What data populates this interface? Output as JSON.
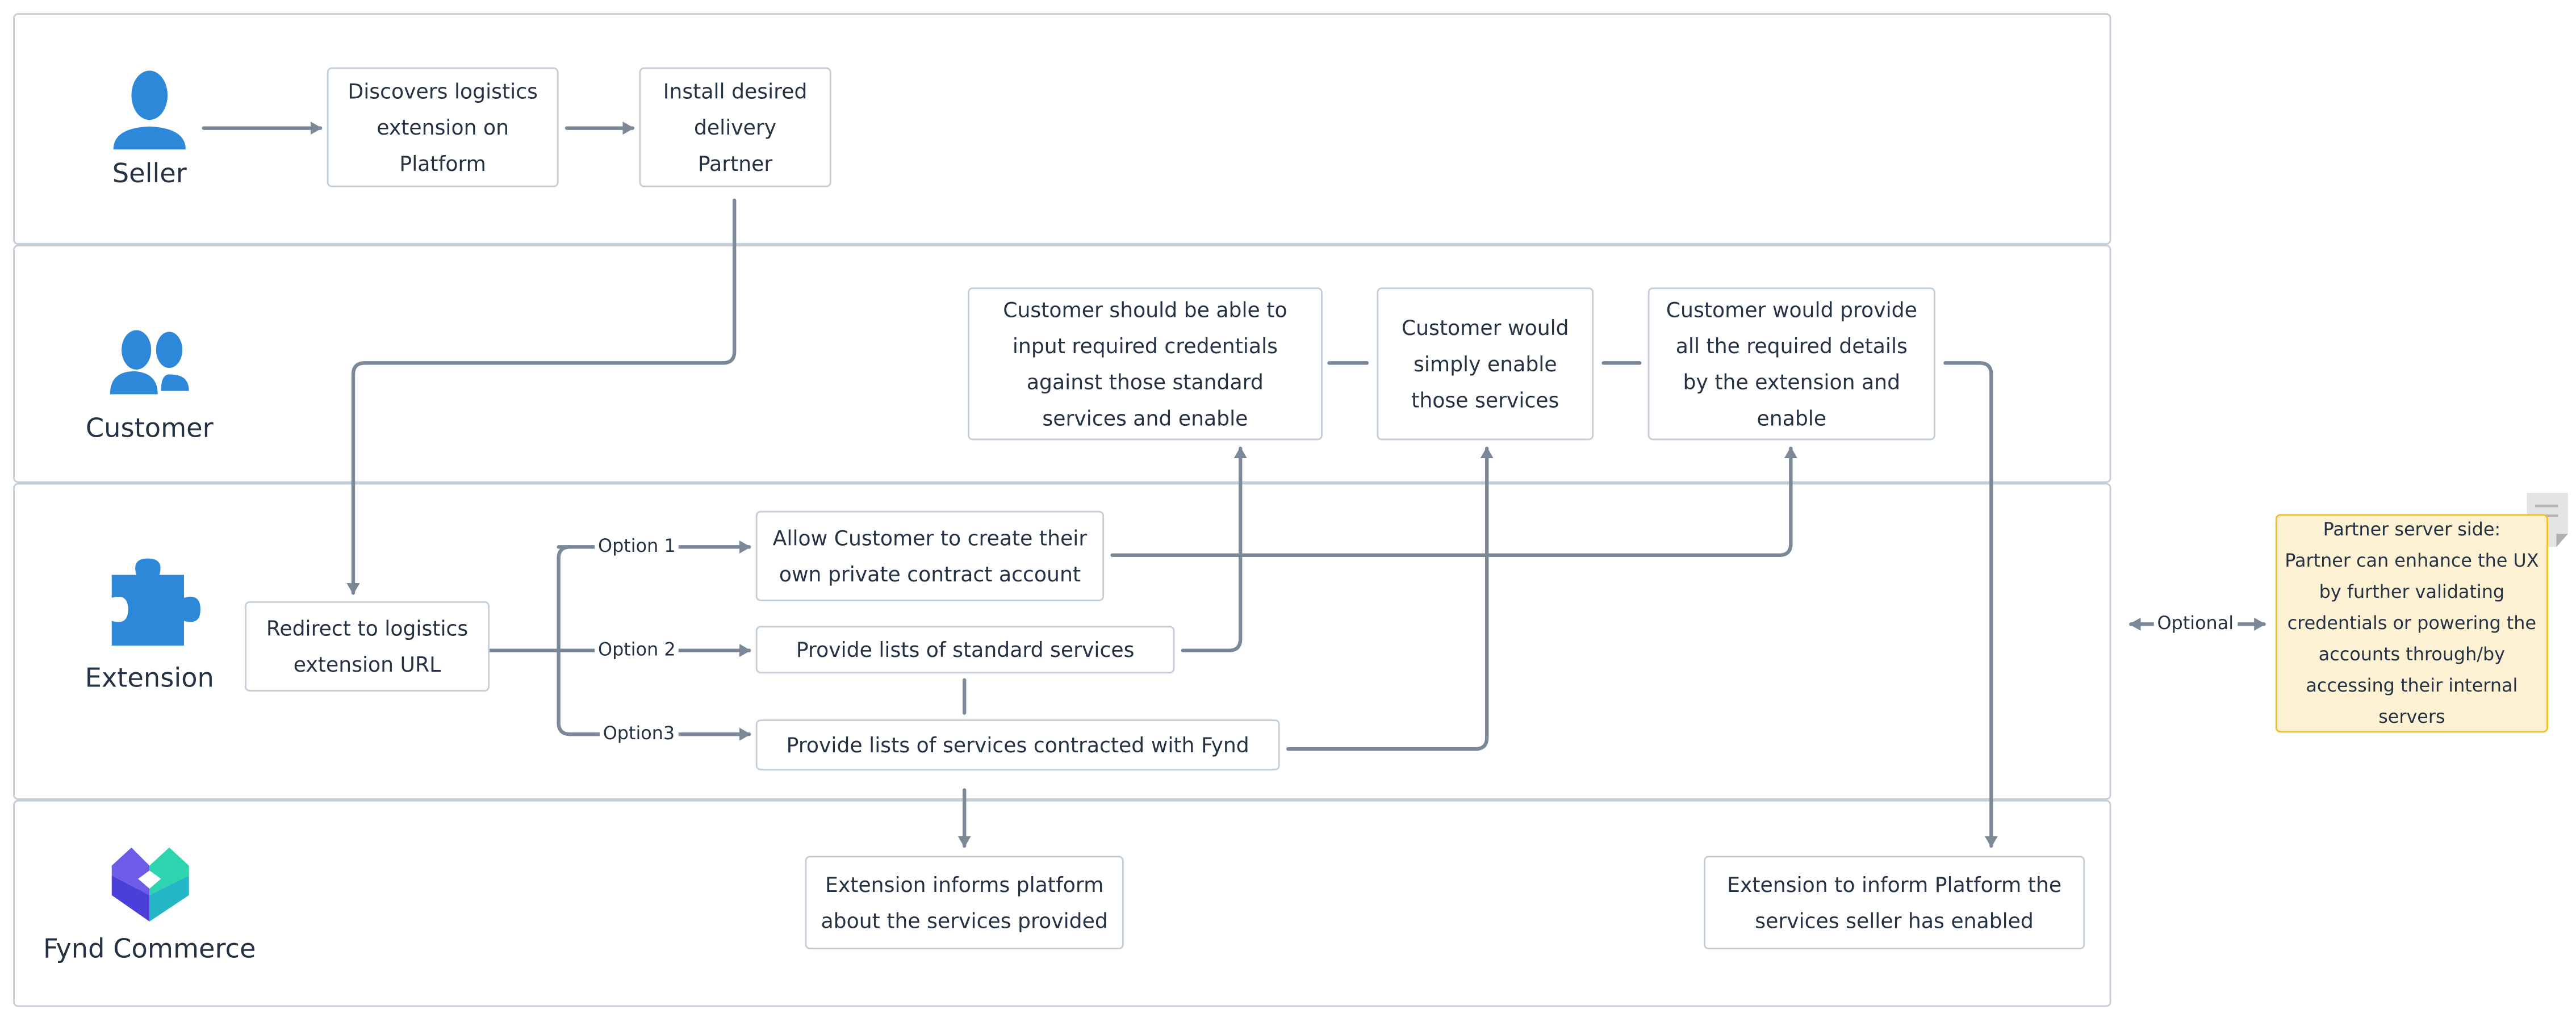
{
  "lanes": [
    {
      "label": "Seller",
      "icon": "person-icon"
    },
    {
      "label": "Customer",
      "icon": "people-icon"
    },
    {
      "label": "Extension",
      "icon": "puzzle-icon"
    },
    {
      "label": "Fynd Commerce",
      "icon": "fynd-logo"
    }
  ],
  "boxes": {
    "discovers": "Discovers logistics\nextension on\nPlatform",
    "install": "Install desired\ndelivery\nPartner",
    "credentials": "Customer should be able to\ninput required credentials\nagainst those standard\nservices and enable",
    "simply_enable": "Customer would\nsimply enable\nthose services",
    "provide_details": "Customer would provide\nall the required details\nby the extension and\nenable",
    "redirect": "Redirect to logistics\nextension URL",
    "allow_account": "Allow Customer to create their\nown private contract account",
    "standard_services": "Provide lists of standard services",
    "contracted_services": "Provide lists of services contracted with Fynd",
    "informs_platform": "Extension informs platform\nabout the services provided",
    "inform_enabled": "Extension to inform Platform the\nservices seller has enabled"
  },
  "options": {
    "option1": "Option 1",
    "option2": "Option 2",
    "option3": "Option3"
  },
  "optional_label": "Optional",
  "note": "Partner server side:\nPartner can enhance the UX\nby further validating\ncredentials or powering the\naccounts through/by\naccessing their internal\nservers",
  "colors": {
    "icon": "#2d88d9",
    "connector": "#7a8898",
    "note_bg": "#fdf1d3",
    "note_border": "#f2bf2a",
    "lane_border": "#c3ced8"
  }
}
